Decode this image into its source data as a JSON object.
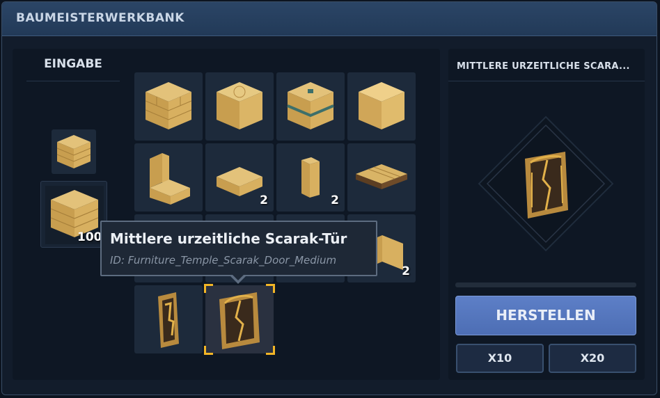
{
  "window": {
    "title": "BAUMEISTERWERKBANK"
  },
  "input": {
    "header": "EINGABE",
    "slots": [
      {
        "icon": "sandstone-brick-block-icon",
        "count": ""
      },
      {
        "icon": "sandstone-brick-block-icon",
        "count": "100"
      }
    ]
  },
  "recipes": [
    {
      "icon": "sandstone-brick-block-icon",
      "count": ""
    },
    {
      "icon": "carved-sandstone-block-icon",
      "count": ""
    },
    {
      "icon": "temple-ornament-block-icon",
      "count": ""
    },
    {
      "icon": "smooth-sandstone-block-icon",
      "count": ""
    },
    {
      "icon": "sandstone-brick-stairs-icon",
      "count": ""
    },
    {
      "icon": "sandstone-brick-slab-icon",
      "count": "2"
    },
    {
      "icon": "sandstone-pillar-icon",
      "count": "2"
    },
    {
      "icon": "wooden-platform-icon",
      "count": ""
    },
    {
      "icon": "sandstone-block-icon",
      "count": ""
    },
    {
      "icon": "sandstone-block-icon",
      "count": ""
    },
    {
      "icon": "sandstone-block-icon",
      "count": ""
    },
    {
      "icon": "sandstone-corner-icon",
      "count": "2"
    },
    {
      "icon": "small-scarak-door-icon",
      "count": ""
    },
    {
      "icon": "medium-scarak-door-icon",
      "count": ""
    }
  ],
  "tooltip": {
    "title": "Mittlere urzeitliche Scarak-Tür",
    "id": "ID: Furniture_Temple_Scarak_Door_Medium"
  },
  "selected_item": {
    "title": "MITTLERE URZEITLICHE SCARA...",
    "icon": "medium-scarak-door-icon"
  },
  "craft": {
    "progress": 0,
    "button_label": "HERSTELLEN",
    "x10_label": "X10",
    "x20_label": "X20"
  },
  "colors": {
    "accent": "#5b7cc4",
    "selection": "#f2b526",
    "sandstone": "#d9b466"
  }
}
